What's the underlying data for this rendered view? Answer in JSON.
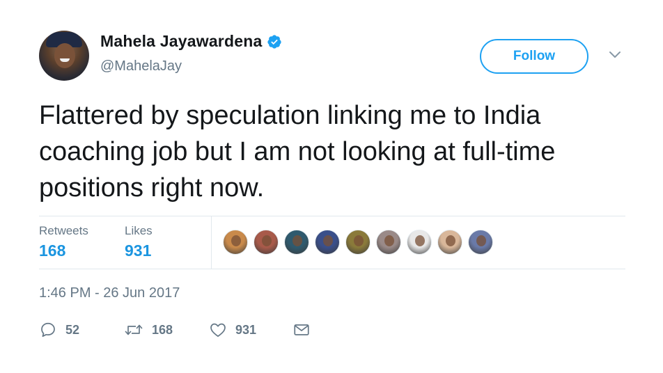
{
  "author": {
    "display_name": "Mahela Jayawardena",
    "handle": "@MahelaJay",
    "verified": true
  },
  "follow_button": {
    "label": "Follow"
  },
  "tweet": {
    "text": "Flattered by speculation linking me to India coaching job but I am not looking at full-time positions right now.",
    "timestamp": "1:46 PM - 26 Jun 2017"
  },
  "stats": {
    "retweets_label": "Retweets",
    "retweets_count": "168",
    "likes_label": "Likes",
    "likes_count": "931"
  },
  "likers": [
    {
      "color": "#c98a4b"
    },
    {
      "color": "#a85a4a"
    },
    {
      "color": "#2f5a6e"
    },
    {
      "color": "#3a4f8a"
    },
    {
      "color": "#8a7a3a"
    },
    {
      "color": "#9a8a88"
    },
    {
      "color": "#e8e8e8"
    },
    {
      "color": "#d9b79a"
    },
    {
      "color": "#6a7aa8"
    }
  ],
  "actions": {
    "reply_count": "52",
    "retweet_count": "168",
    "like_count": "931"
  },
  "colors": {
    "accent": "#1da1f2",
    "stat_value": "#1b95e0",
    "muted": "#657786",
    "text": "#14171a",
    "border": "#e1e8ed"
  }
}
